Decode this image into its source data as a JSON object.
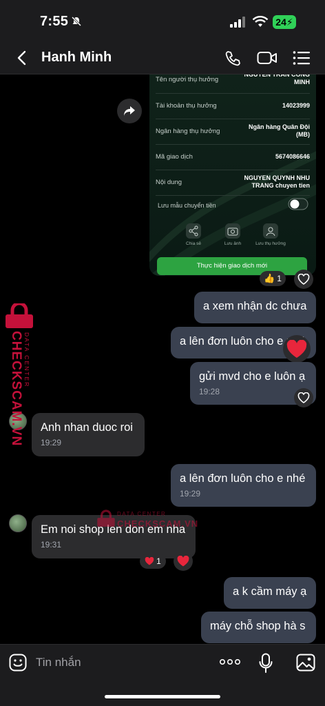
{
  "status": {
    "time": "7:55",
    "battery": "24"
  },
  "header": {
    "title": "Hanh Minh"
  },
  "transfer_card": {
    "rows": [
      {
        "label": "Tên người thụ hưởng",
        "value": "NGUYEN TRAN CONG MINH"
      },
      {
        "label": "Tài khoản thụ hưởng",
        "value": "14023999"
      },
      {
        "label": "Ngân hàng thụ hưởng",
        "value": "Ngân hàng Quân Đội (MB)"
      },
      {
        "label": "Mã giao dịch",
        "value": "5674086646"
      },
      {
        "label": "Nội dung",
        "value": "NGUYEN QUYNH NHU TRANG chuyen tien"
      }
    ],
    "save_template_label": "Lưu mẫu chuyển tiền",
    "actions": [
      "Chia sẻ",
      "Lưu ảnh",
      "Lưu thụ hưởng"
    ],
    "new_transaction": "Thực hiện giao dịch mới",
    "reaction_count": "1"
  },
  "messages": [
    {
      "dir": "out",
      "text": "a xem nhận dc chưa",
      "time": ""
    },
    {
      "dir": "out",
      "text": "a lên đơn luôn cho e nhé",
      "time": ""
    },
    {
      "dir": "out",
      "text": "gửi mvd cho e luôn ạ",
      "time": "19:28"
    },
    {
      "dir": "in",
      "text": "Anh nhan duoc roi",
      "time": "19:29"
    },
    {
      "dir": "out",
      "text": "a lên đơn luôn cho e nhé",
      "time": "19:29"
    },
    {
      "dir": "in",
      "text": "Em noi shop len don em nha",
      "time": "19:31"
    },
    {
      "dir": "out",
      "text": "a k cầm máy ạ",
      "time": ""
    },
    {
      "dir": "out",
      "text": "máy chỗ shop hà s",
      "time": ""
    }
  ],
  "reaction_em_count": "1",
  "watermark": {
    "brand": "CHECKSCAM.VN",
    "sub": "DATA CENTER"
  },
  "input": {
    "placeholder": "Tin nhắn"
  },
  "colors": {
    "accent_green": "#2da341",
    "bubble_out": "#3a4150",
    "bubble_in": "#2c2c2e",
    "watermark": "#c4113a"
  }
}
